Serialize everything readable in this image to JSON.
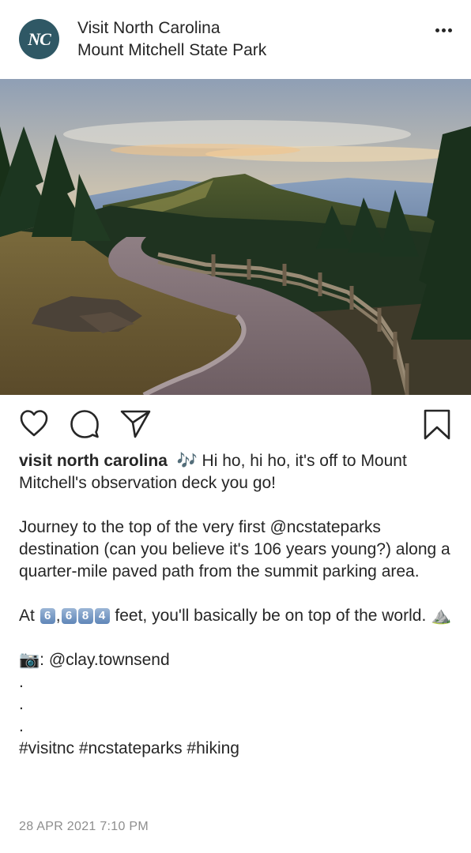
{
  "post": {
    "account_name": "Visit North Carolina",
    "location": "Mount Mitchell State Park",
    "avatar_text": "NC",
    "caption": {
      "username": "visit north carolina",
      "music_emoji": "🎶",
      "line1": "Hi ho, hi ho, it's off to Mount Mitchell's observation deck you go!",
      "line2": "Journey to the top of the very first @ncstateparks destination (can you believe it's 106 years young?) along a quarter-mile paved path from the summit parking area.",
      "line3_prefix": "At",
      "digits": [
        "6",
        "6",
        "8",
        "4"
      ],
      "comma": ",",
      "line3_suffix": "feet, you'll basically be on top of the world.",
      "mountain_emoji": "⛰️",
      "camera_emoji": "📷",
      "credit": ": @clay.townsend",
      "dots": [
        ".",
        ".",
        "."
      ],
      "hashtags": "#visitnc #ncstateparks #hiking"
    },
    "timestamp": "28 APR 2021 7:10 PM"
  },
  "icons": {
    "like": "heart-icon",
    "comment": "comment-bubble-icon",
    "share": "paper-plane-icon",
    "save": "bookmark-icon",
    "more": "more-options-icon"
  }
}
